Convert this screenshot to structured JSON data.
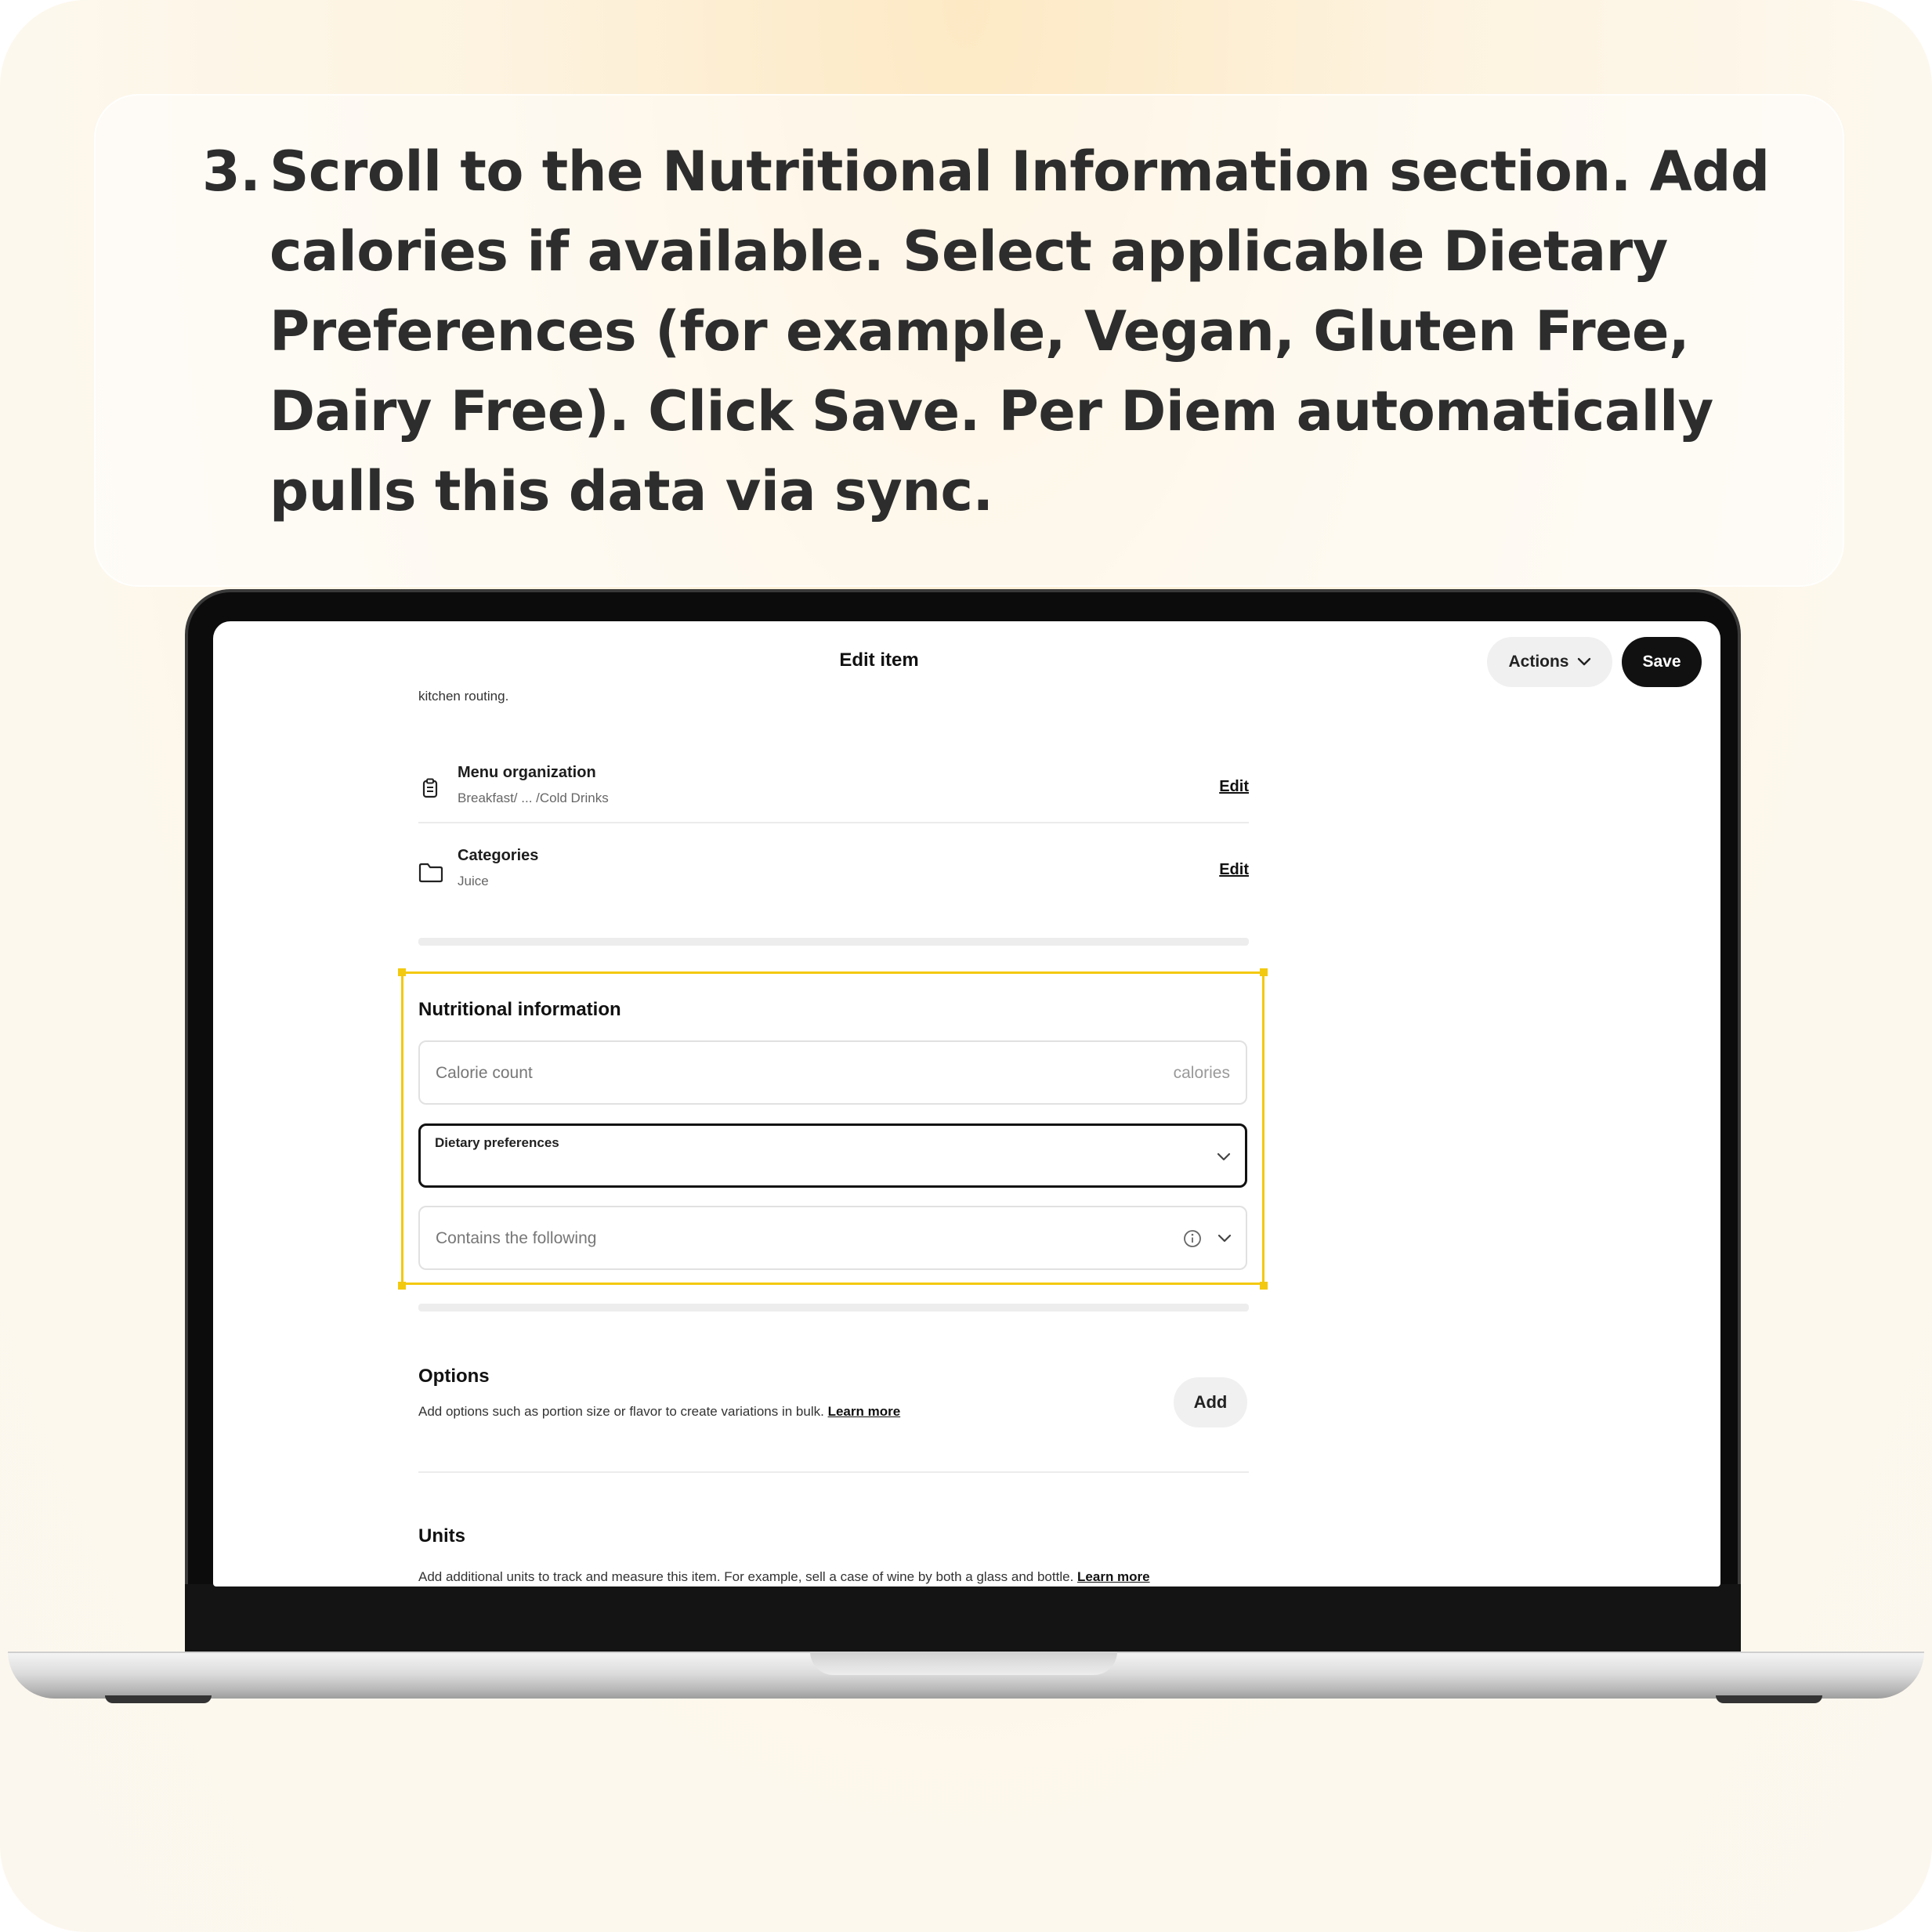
{
  "instruction": {
    "number": "3.",
    "text": "Scroll to the Nutritional Information section. Add calories if available. Select applicable Dietary Preferences (for example, Vegan, Gluten Free, Dairy Free). Click Save. Per Diem automatically pulls this data via sync."
  },
  "header": {
    "title": "Edit item",
    "actions_label": "Actions",
    "save_label": "Save"
  },
  "details": {
    "truncated_text": "kitchen routing."
  },
  "rows": [
    {
      "title": "Menu organization",
      "subtitle": "Breakfast/ ... /Cold Drinks",
      "action": "Edit",
      "icon": "clipboard-icon"
    },
    {
      "title": "Categories",
      "subtitle": "Juice",
      "action": "Edit",
      "icon": "folder-icon"
    }
  ],
  "nutrition": {
    "title": "Nutritional information",
    "calorie_placeholder": "Calorie count",
    "calorie_unit": "calories",
    "dietary_label": "Dietary preferences",
    "contains_placeholder": "Contains the following"
  },
  "options": {
    "title": "Options",
    "description": "Add options such as portion size or flavor to create variations in bulk.",
    "learn_more": "Learn more",
    "add_label": "Add"
  },
  "units": {
    "title": "Units",
    "description": "Add additional units to track and measure this item. For example, sell a case of wine by both a glass and bottle.",
    "learn_more": "Learn more"
  },
  "colors": {
    "highlight": "#f3c90f",
    "primary_button": "#111111",
    "secondary_button": "#f0f0f0"
  }
}
